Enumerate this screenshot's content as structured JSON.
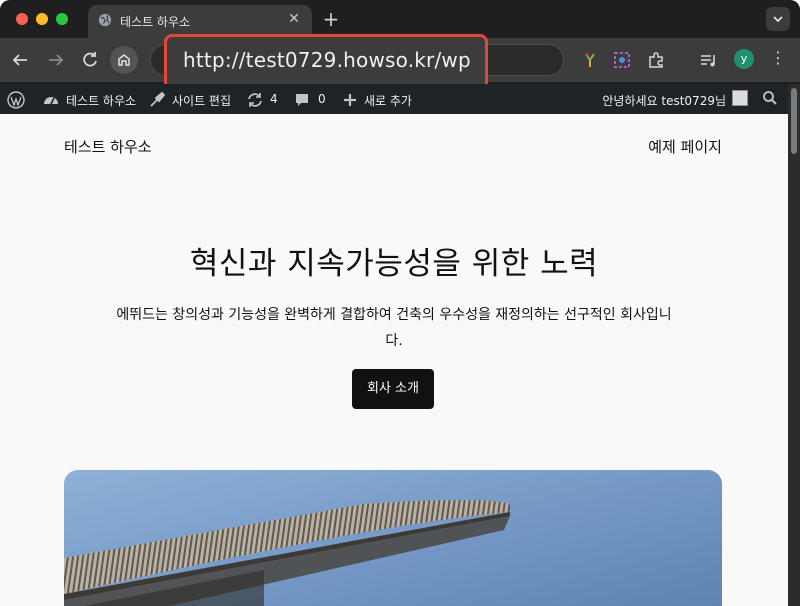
{
  "browser": {
    "tab_title": "테스트 하우소",
    "tab_close": "✕",
    "new_tab": "+",
    "url": "http://test0729.howso.kr/wp",
    "avatar_letter": "y",
    "highlight_color": "#e1483c"
  },
  "adminbar": {
    "site_name": "테스트 하우소",
    "edit_site": "사이트 편집",
    "updates_count": "4",
    "comments_count": "0",
    "new_item": "새로 추가",
    "greeting": "안녕하세요 test0729님"
  },
  "site": {
    "title": "테스트 하우소",
    "nav_item": "예제 페이지"
  },
  "hero": {
    "title": "혁신과 지속가능성을 위한 노력",
    "description": "에뛰드는 창의성과 기능성을 완벽하게 결합하여 건축의 우수성을 재정의하는 선구적인 회사입니다.",
    "button": "회사 소개"
  },
  "icons": {
    "globe": "globe-icon",
    "back": "back-arrow-icon",
    "forward": "forward-arrow-icon",
    "reload": "reload-icon",
    "home": "home-icon",
    "wordpress": "wordpress-logo-icon",
    "dashboard": "dashboard-icon",
    "brush": "brush-icon",
    "updates": "updates-icon",
    "comments": "comment-icon",
    "plus": "plus-icon",
    "search": "search-icon"
  }
}
